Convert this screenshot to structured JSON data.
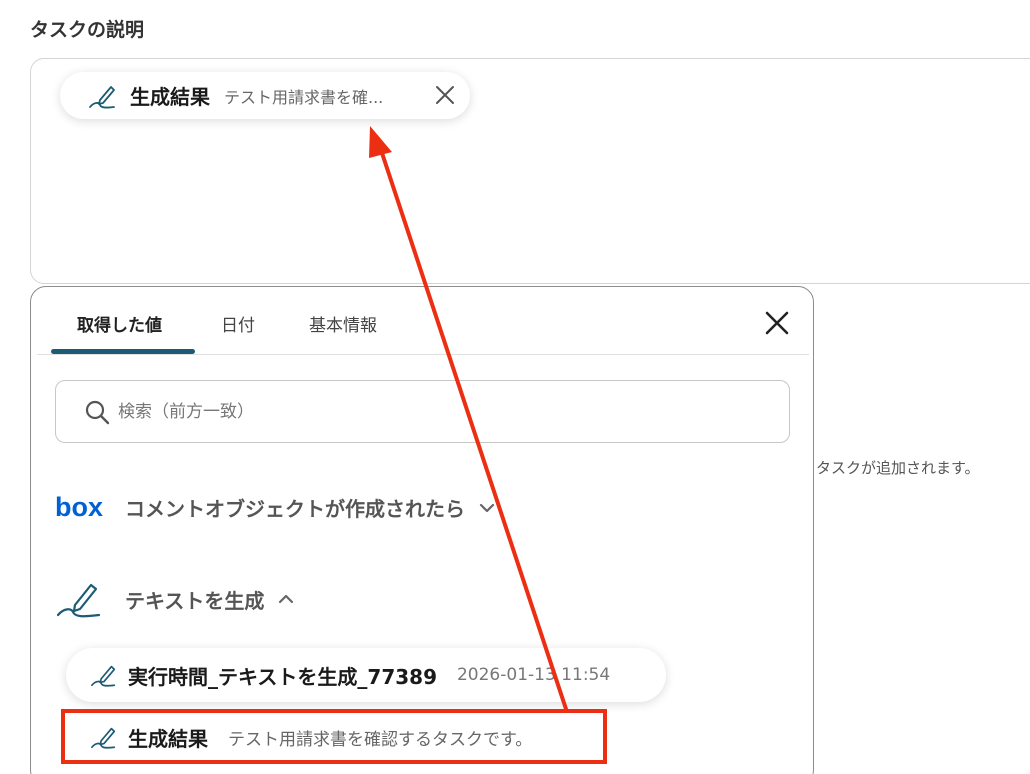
{
  "section_title": "タスクの説明",
  "top_chip": {
    "label": "生成結果",
    "value": "テスト用請求書を確..."
  },
  "helper_text": "タスクが追加されます。",
  "panel": {
    "tabs": [
      {
        "label": "取得した値",
        "active": true
      },
      {
        "label": "日付",
        "active": false
      },
      {
        "label": "基本情報",
        "active": false
      }
    ],
    "search_placeholder": "検索（前方一致）",
    "groups": [
      {
        "label": "コメントオブジェクトが作成されたら",
        "icon": "box-logo-icon",
        "expanded": false
      },
      {
        "label": "テキストを生成",
        "icon": "pen-icon",
        "expanded": true
      }
    ],
    "items": [
      {
        "label": "実行時間_テキストを生成_77389",
        "value": "2026-01-13 11:54"
      },
      {
        "label": "生成結果",
        "value": "テスト用請求書を確認するタスクです。"
      }
    ]
  },
  "logo": {
    "box_text": "box"
  },
  "colors": {
    "accent": "#1c5b73",
    "annotation": "#ec2f12",
    "box_brand": "#0061d5"
  }
}
